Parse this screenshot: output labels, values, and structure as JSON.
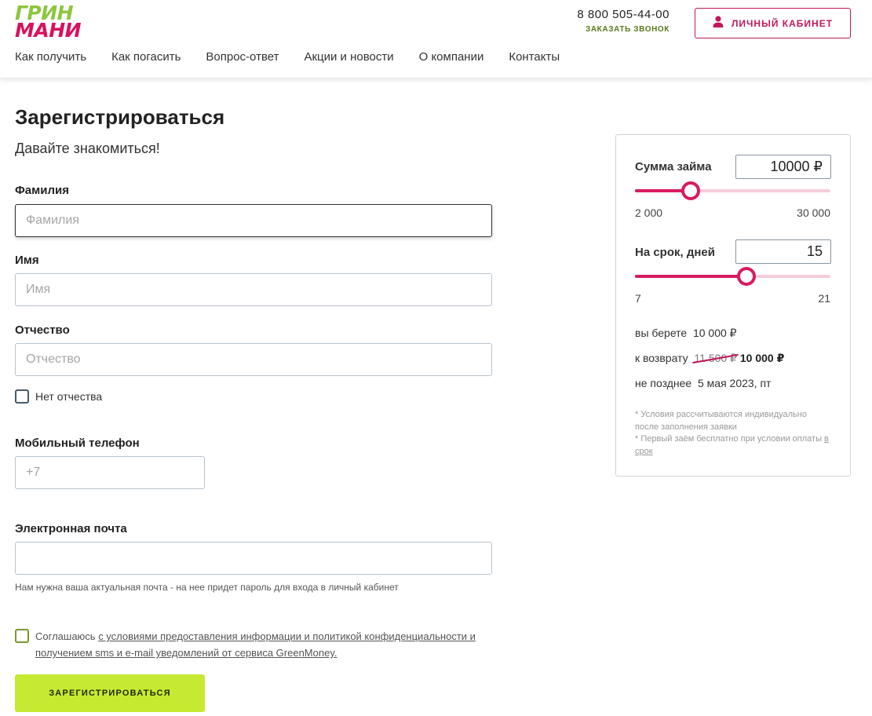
{
  "header": {
    "logo_top": "ГРИН",
    "logo_bottom": "МАНИ",
    "nav": [
      "Как получить",
      "Как погасить",
      "Вопрос-ответ",
      "Акции и новости",
      "О компании",
      "Контакты"
    ],
    "phone": "8 800 505-44-00",
    "call_label": "ЗАКАЗАТЬ ЗВОНОК",
    "cabinet_label": "ЛИЧНЫЙ КАБИНЕТ"
  },
  "form": {
    "title": "Зарегистрироваться",
    "subtitle": "Давайте знакомиться!",
    "surname_label": "Фамилия",
    "surname_placeholder": "Фамилия",
    "name_label": "Имя",
    "name_placeholder": "Имя",
    "patronymic_label": "Отчество",
    "patronymic_placeholder": "Отчество",
    "no_patronymic_label": "Нет отчества",
    "phone_label": "Мобильный телефон",
    "phone_placeholder": "+7",
    "email_label": "Электронная почта",
    "email_placeholder": "",
    "email_hint": "Нам нужна ваша актуальная почта - на нее придет пароль для входа в личный кабинет",
    "agree_prefix": "Соглашаюсь ",
    "agree_link": "с условиями предоставления информации и политикой конфиденциальности и получением sms и e-mail уведомлений от сервиса GreenMoney.",
    "submit_label": "ЗАРЕГИСТРИРОВАТЬСЯ"
  },
  "calculator": {
    "amount_label": "Сумма займа",
    "amount_value": "10000 ₽",
    "amount_min": "2 000",
    "amount_max": "30 000",
    "amount_fraction": 0.286,
    "term_label": "На срок, дней",
    "term_value": "15",
    "term_min": "7",
    "term_max": "21",
    "term_fraction": 0.571,
    "take_label": "вы берете",
    "take_value": "10 000 ₽",
    "return_label": "к возврату",
    "return_old": "11 500 ₽",
    "return_new": "10 000 ₽",
    "deadline_label": "не позднее",
    "deadline_value": "5 мая 2023, пт",
    "note1": "* Условия рассчитываются индивидуально после заполнения заявки",
    "note2_prefix": "* Первый заём бесплатно при условии оплаты ",
    "note2_link": "в срок"
  },
  "colors": {
    "brand_green": "#8cc63f",
    "brand_pink": "#d8115e",
    "button_green": "#c6ea31"
  }
}
